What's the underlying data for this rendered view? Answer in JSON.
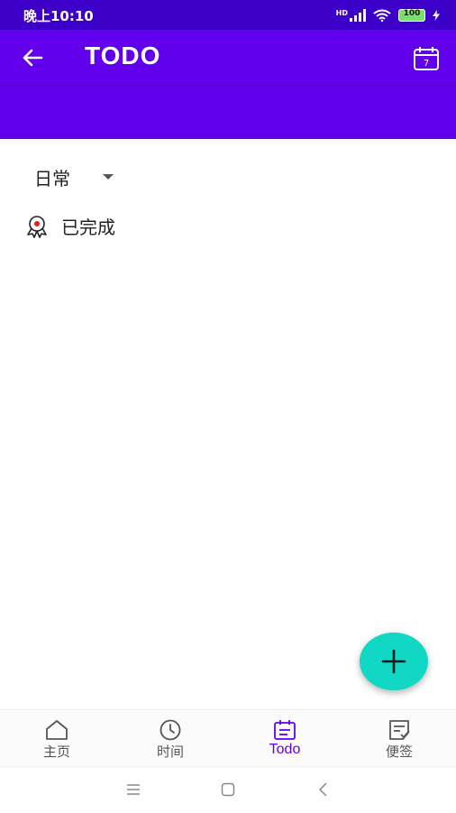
{
  "status_bar": {
    "time": "晚上10:10",
    "network": "HD",
    "battery": "100"
  },
  "app_bar": {
    "title": "TODO",
    "calendar_day": "7"
  },
  "category_dropdown": {
    "selected": "日常"
  },
  "completed_section": {
    "label": "已完成"
  },
  "bottom_nav": {
    "items": [
      {
        "label": "主页",
        "icon": "home-icon"
      },
      {
        "label": "时间",
        "icon": "clock-icon"
      },
      {
        "label": "Todo",
        "icon": "todo-icon",
        "active": true
      },
      {
        "label": "便签",
        "icon": "note-icon"
      }
    ]
  },
  "colors": {
    "primary": "#6200ee",
    "status_bar": "#3d00c8",
    "fab": "#10d8c4"
  }
}
